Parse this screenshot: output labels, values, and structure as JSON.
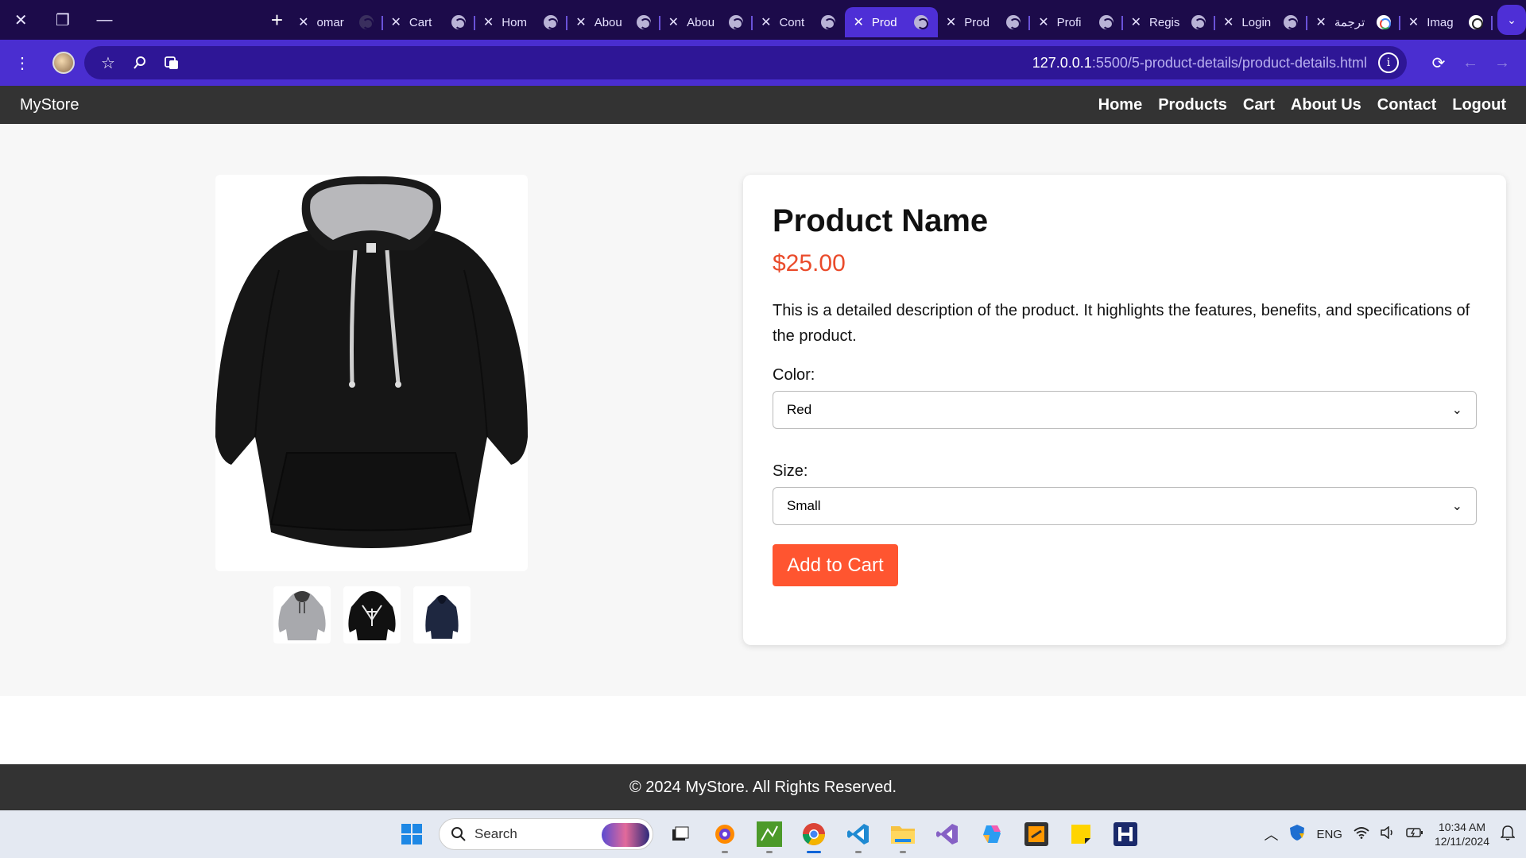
{
  "browser": {
    "tabs": [
      {
        "label": "omar",
        "favicon": "github-icon"
      },
      {
        "label": "Cart",
        "favicon": "globe-icon"
      },
      {
        "label": "Hom",
        "favicon": "globe-icon"
      },
      {
        "label": "Abou",
        "favicon": "globe-icon"
      },
      {
        "label": "Abou",
        "favicon": "globe-icon"
      },
      {
        "label": "Cont",
        "favicon": "globe-icon"
      },
      {
        "label": "Prod",
        "favicon": "globe-icon",
        "active": true
      },
      {
        "label": "Prod",
        "favicon": "globe-icon"
      },
      {
        "label": "Profi",
        "favicon": "globe-icon"
      },
      {
        "label": "Regis",
        "favicon": "globe-icon"
      },
      {
        "label": "Login",
        "favicon": "globe-icon"
      },
      {
        "label": "ترجمة",
        "favicon": "google-icon"
      },
      {
        "label": "Imag",
        "favicon": "chatgpt-icon"
      }
    ],
    "url_host": "127.0.0.1",
    "url_path": ":5500/5-product-details/product-details.html",
    "colors": {
      "tabstrip": "#1c0b4a",
      "toolbar": "#4a2ed0",
      "active_tab": "#4e2fd6"
    }
  },
  "site": {
    "brand": "MyStore",
    "nav": [
      "Home",
      "Products",
      "Cart",
      "About Us",
      "Contact",
      "Logout"
    ]
  },
  "product": {
    "name": "Product Name",
    "price": "$25.00",
    "description": "This is a detailed description of the product. It highlights the features, benefits, and specifications of the product.",
    "color_label": "Color:",
    "color_value": "Red",
    "size_label": "Size:",
    "size_value": "Small",
    "add_to_cart": "Add to Cart",
    "accent_color": "#ff5530"
  },
  "footer": {
    "text": "© 2024 MyStore. All Rights Reserved."
  },
  "taskbar": {
    "search_placeholder": "Search",
    "language": "ENG",
    "time": "10:34 AM",
    "date": "12/11/2024"
  }
}
